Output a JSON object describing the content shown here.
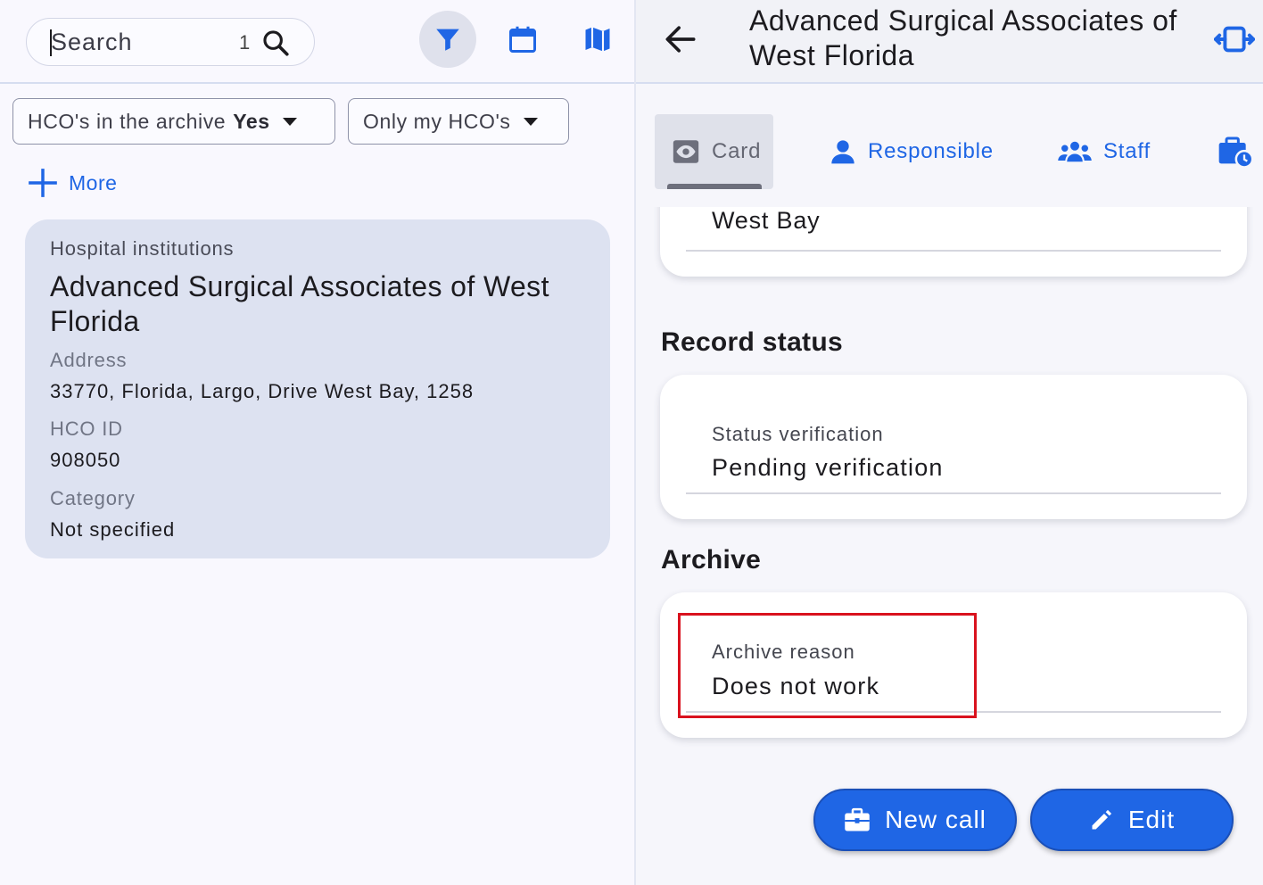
{
  "search": {
    "placeholder": "Search",
    "count": "1"
  },
  "filters": {
    "archive_label": "HCO's in the archive",
    "archive_value": "Yes",
    "mine_label": "Only my HCO's",
    "more_label": "More"
  },
  "result": {
    "type": "Hospital institutions",
    "name": "Advanced Surgical Associates of West Florida",
    "address_label": "Address",
    "address": "33770, Florida, Largo, Drive West Bay, 1258",
    "id_label": "HCO ID",
    "id": "908050",
    "category_label": "Category",
    "category": "Not specified"
  },
  "detail": {
    "title": "Advanced Surgical Associates of West Florida",
    "tabs": [
      {
        "label": "Card"
      },
      {
        "label": "Responsible"
      },
      {
        "label": "Staff"
      }
    ],
    "address_tail": "West Bay",
    "record_status_title": "Record status",
    "status_label": "Status verification",
    "status_value": "Pending verification",
    "archive_title": "Archive",
    "archive_reason_label": "Archive reason",
    "archive_reason_value": "Does not work",
    "new_call_label": "New call",
    "edit_label": "Edit"
  },
  "colors": {
    "accent": "#1f66e5",
    "card_bg": "#dde2f1",
    "highlight": "#d9121e"
  },
  "icons": [
    "search-icon",
    "filter-icon",
    "calendar-icon",
    "map-icon",
    "plus-icon",
    "back-arrow-icon",
    "expand-icon",
    "eye-icon",
    "person-icon",
    "group-icon",
    "briefcase-clock-icon",
    "briefcase-icon",
    "pencil-icon"
  ]
}
